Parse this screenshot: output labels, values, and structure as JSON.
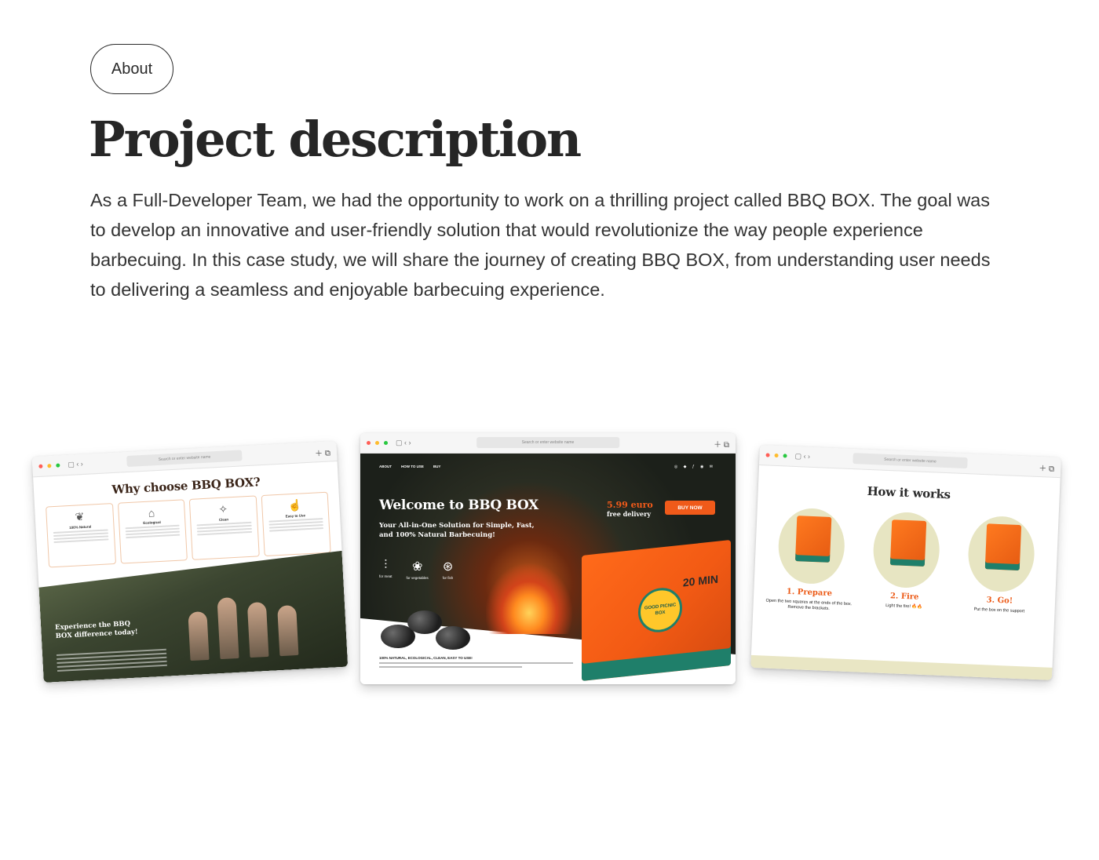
{
  "about_label": "About",
  "title": "Project description",
  "description": "As a Full-Developer Team, we had the opportunity to work on a thrilling project called BBQ BOX. The goal was to develop an innovative and user-friendly solution that would revolutionize the way people experience barbecuing. In this case study, we will share the journey of creating BBQ BOX, from understanding user needs to delivering a seamless and enjoyable barbecuing experience.",
  "browser": {
    "url_placeholder": "Search or enter website name"
  },
  "mock_left": {
    "heading": "Why choose BBQ BOX?",
    "features": [
      {
        "name": "100% Natural",
        "icon": "leaf-icon"
      },
      {
        "name": "Ecological",
        "icon": "house-icon"
      },
      {
        "name": "Clean",
        "icon": "sparkle-icon"
      },
      {
        "name": "Easy to Use",
        "icon": "hand-icon"
      }
    ],
    "cta_title": "Experience the BBQ BOX difference today!"
  },
  "mock_middle": {
    "nav": [
      "ABOUT",
      "HOW TO USE",
      "BUY"
    ],
    "hero_title": "Welcome to BBQ BOX",
    "hero_subtitle": "Your All-in-One Solution for Simple, Fast, and 100% Natural Barbecuing!",
    "price": "5.99 euro",
    "delivery": "free delivery",
    "buy_label": "BUY NOW",
    "icons": [
      {
        "label": "for meat",
        "icon": "skewer-icon"
      },
      {
        "label": "for vegetables",
        "icon": "vegetables-icon"
      },
      {
        "label": "for fish",
        "icon": "fish-icon"
      }
    ],
    "box_badge": "GOOD PICNIC BOX",
    "box_time": "20 MIN",
    "footer_line": "100% NATURAL, ECOLOGICAL, CLEAN, EASY TO USE!"
  },
  "mock_right": {
    "heading": "How it works",
    "steps": [
      {
        "name": "1. Prepare",
        "desc": "Open the two squares at the ends of the box. Remove the brackets."
      },
      {
        "name": "2. Fire",
        "desc": "Light the fire! 🔥🔥"
      },
      {
        "name": "3. Go!",
        "desc": "Put the box on the support"
      }
    ]
  }
}
